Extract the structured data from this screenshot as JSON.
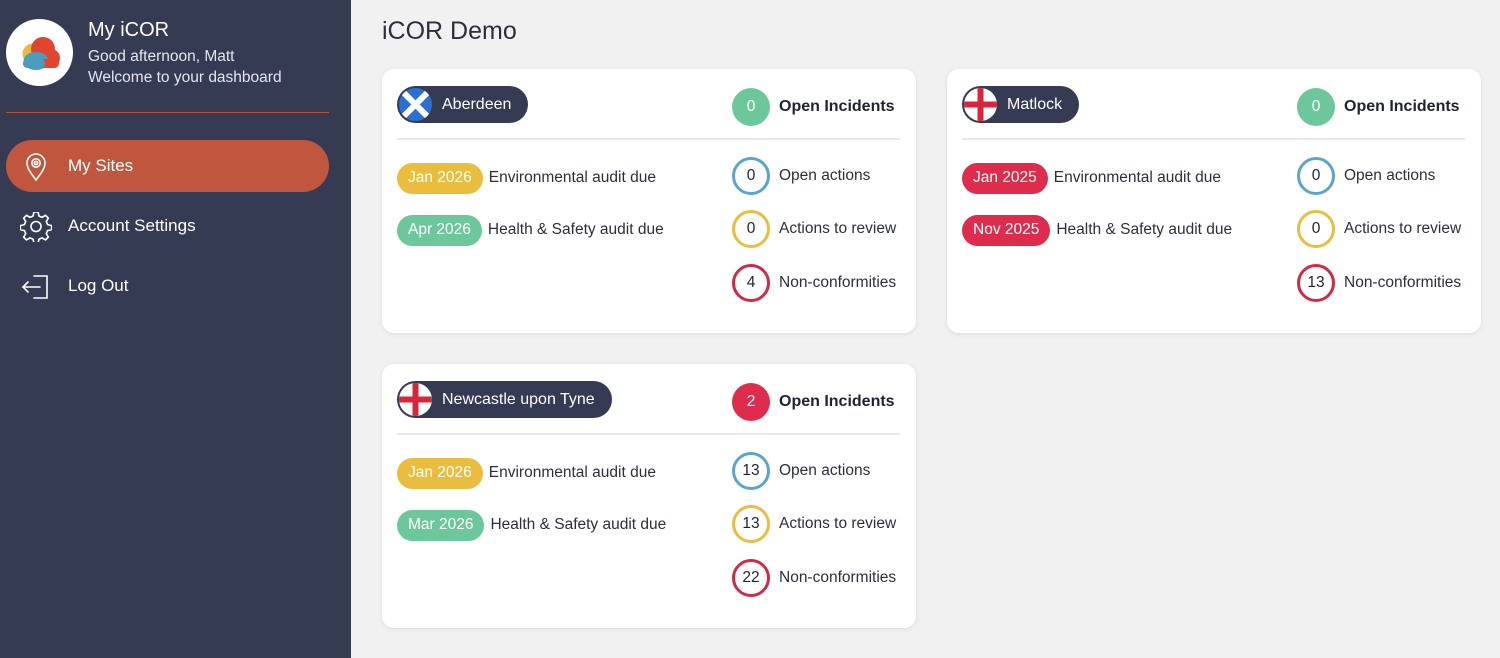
{
  "colors": {
    "sidebar_bg": "#353b53",
    "active_nav": "#c0563e",
    "page_bg": "#f1f1f1",
    "green": "#6cc79a",
    "yellow": "#eabd3f",
    "red": "#dd2c4c",
    "blue_ring": "#5aa6c8",
    "yellow_ring": "#eabd3f",
    "red_ring": "#cf2a46"
  },
  "sidebar": {
    "app_title": "My iCOR",
    "greeting": "Good afternoon, Matt",
    "welcome": "Welcome to your dashboard",
    "logo_icon": "cloud-logo-icon",
    "nav": [
      {
        "label": "My Sites",
        "icon": "location-pin-icon",
        "active": true
      },
      {
        "label": "Account Settings",
        "icon": "gear-icon",
        "active": false
      },
      {
        "label": "Log Out",
        "icon": "logout-icon",
        "active": false
      }
    ]
  },
  "main": {
    "title": "iCOR Demo",
    "sites": [
      {
        "name": "Aberdeen",
        "flag": "scotland-flag-icon",
        "open_incidents": {
          "count": "0",
          "label": "Open Incidents",
          "color": "#6cc79a"
        },
        "audits": [
          {
            "date": "Jan 2026",
            "label": "Environmental audit due",
            "color": "#eabd3f"
          },
          {
            "date": "Apr 2026",
            "label": "Health & Safety audit due",
            "color": "#6cc79a"
          }
        ],
        "metrics": [
          {
            "count": "0",
            "label": "Open actions",
            "ring": "#5aa6c8"
          },
          {
            "count": "0",
            "label": "Actions to review",
            "ring": "#eabd3f"
          },
          {
            "count": "4",
            "label": "Non-conformities",
            "ring": "#cf2a46"
          }
        ]
      },
      {
        "name": "Matlock",
        "flag": "england-flag-icon",
        "open_incidents": {
          "count": "0",
          "label": "Open Incidents",
          "color": "#6cc79a"
        },
        "audits": [
          {
            "date": "Jan 2025",
            "label": "Environmental audit due",
            "color": "#dd2c4c"
          },
          {
            "date": "Nov 2025",
            "label": "Health & Safety audit due",
            "color": "#dd2c4c"
          }
        ],
        "metrics": [
          {
            "count": "0",
            "label": "Open actions",
            "ring": "#5aa6c8"
          },
          {
            "count": "0",
            "label": "Actions to review",
            "ring": "#eabd3f"
          },
          {
            "count": "13",
            "label": "Non-conformities",
            "ring": "#cf2a46"
          }
        ]
      },
      {
        "name": "Newcastle upon Tyne",
        "flag": "england-flag-icon",
        "open_incidents": {
          "count": "2",
          "label": "Open Incidents",
          "color": "#dd2c4c"
        },
        "audits": [
          {
            "date": "Jan 2026",
            "label": "Environmental audit due",
            "color": "#eabd3f"
          },
          {
            "date": "Mar 2026",
            "label": "Health & Safety audit due",
            "color": "#6cc79a"
          }
        ],
        "metrics": [
          {
            "count": "13",
            "label": "Open actions",
            "ring": "#5aa6c8"
          },
          {
            "count": "13",
            "label": "Actions to review",
            "ring": "#eabd3f"
          },
          {
            "count": "22",
            "label": "Non-conformities",
            "ring": "#cf2a46"
          }
        ]
      }
    ]
  }
}
